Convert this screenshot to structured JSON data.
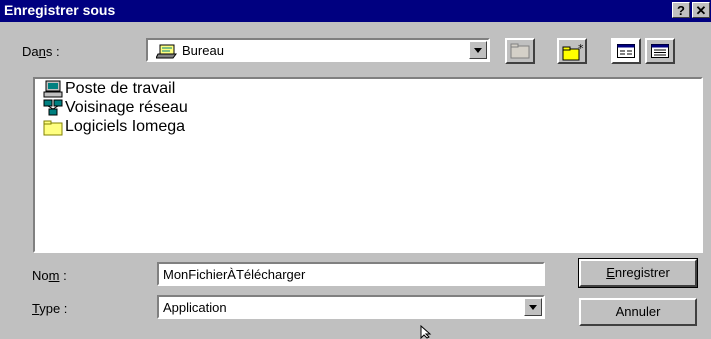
{
  "window": {
    "title": "Enregistrer sous"
  },
  "title_buttons": {
    "help": "?",
    "close": "✕"
  },
  "location": {
    "label_pre": "Da",
    "label_ul": "n",
    "label_post": "s :",
    "value": "Bureau"
  },
  "toolbar": [
    "up-folder-icon",
    "new-folder-icon",
    "list-view-icon",
    "details-view-icon"
  ],
  "files": [
    {
      "name": "Poste de travail",
      "icon": "computer-icon"
    },
    {
      "name": "Voisinage réseau",
      "icon": "network-icon"
    },
    {
      "name": "Logiciels Iomega",
      "icon": "folder-icon"
    }
  ],
  "filename": {
    "label_pre": "No",
    "label_ul": "m",
    "label_post": " :",
    "value": "MonFichierÀTélécharger"
  },
  "filetype": {
    "label_ul": "T",
    "label_post": "ype :",
    "value": "Application"
  },
  "buttons": {
    "save_ul": "E",
    "save_rest": "nregistrer",
    "cancel": "Annuler"
  }
}
